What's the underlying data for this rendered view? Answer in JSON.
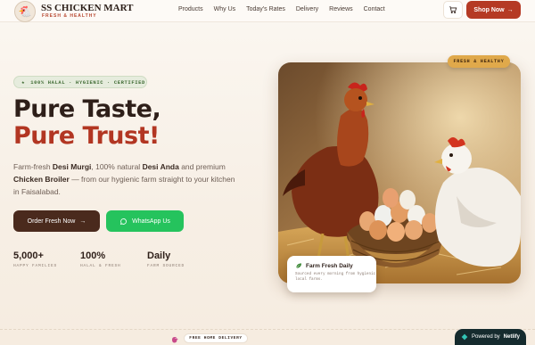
{
  "brand": {
    "name": "SS CHICKEN MART",
    "tagline": "FRESH & HEALTHY"
  },
  "nav": {
    "links": [
      "Products",
      "Why Us",
      "Today's Rates",
      "Delivery",
      "Reviews",
      "Contact"
    ],
    "cart_icon": "cart-icon",
    "shop_now": "Shop Now",
    "shop_now_arrow": "→"
  },
  "hero": {
    "badge": "100% HALAL · HYGIENIC · CERTIFIED",
    "badge_icon": "★",
    "title_line1": "Pure Taste,",
    "title_line2": "Pure Trust!",
    "desc": {
      "p1": "Farm-fresh ",
      "b1": "Desi Murgi",
      "p2": ", 100% natural ",
      "b2": "Desi Anda",
      "p3": " and premium ",
      "b3": "Chicken Broiler",
      "p4": " — from our hygienic farm straight to your kitchen in Faisalabad."
    },
    "order_btn": "Order Fresh Now",
    "order_arrow": "→",
    "whatsapp_btn": "WhatsApp Us",
    "stats": [
      {
        "num": "5,000+",
        "label": "HAPPY FAMILIES"
      },
      {
        "num": "100%",
        "label": "HALAL & FRESH"
      },
      {
        "num": "Daily",
        "label": "FARM SOURCED"
      }
    ],
    "image_tag": "FRESH & HEALTHY",
    "farm_card": {
      "title": "Farm Fresh Daily",
      "subtitle": "Sourced every morning from hygienic local farms."
    }
  },
  "footer": {
    "delivery_pill": "FREE HOME DELIVERY",
    "netlify_prefix": "Powered by",
    "netlify_name": "Netlify"
  },
  "colors": {
    "accent_red": "#b53a24",
    "dark_brown": "#4a2a1d",
    "whatsapp_green": "#25c35d",
    "tag_gold": "#e0a94b"
  }
}
